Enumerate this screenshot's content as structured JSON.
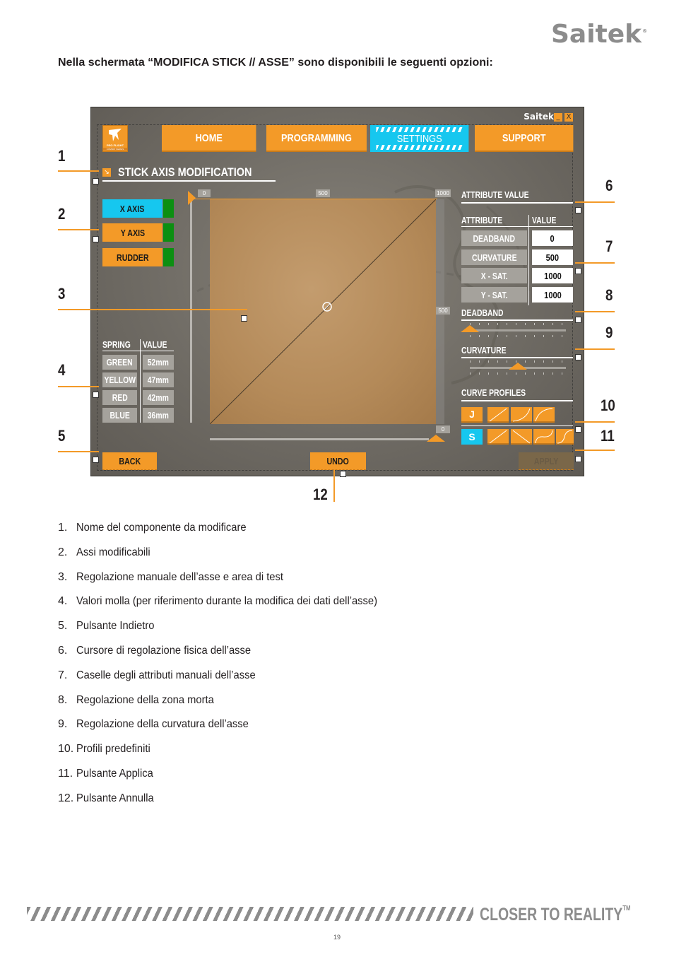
{
  "header": {
    "brand": "Saitek",
    "brand_mark": "®"
  },
  "intro": "Nella schermata “MODIFICA STICK // ASSE” sono disponibili le seguenti opzioni:",
  "app": {
    "brand": "Saitek",
    "minimize_label": "_",
    "close_label": "X",
    "logo_line1": "PRO FLIGHT",
    "logo_line2": "COMBAT SERIES",
    "nav": [
      {
        "label": "HOME",
        "active": false
      },
      {
        "label": "PROGRAMMING",
        "active": false
      },
      {
        "label": "SETTINGS",
        "active": true
      },
      {
        "label": "SUPPORT",
        "active": false
      }
    ],
    "section_title": "STICK  AXIS MODIFICATION",
    "section_icon": "↘",
    "axes": [
      {
        "label": "X AXIS",
        "selected": true
      },
      {
        "label": "Y AXIS",
        "selected": false
      },
      {
        "label": "RUDDER",
        "selected": false
      }
    ],
    "spring": {
      "col_spring": "SPRING",
      "col_value": "VALUE",
      "rows": [
        {
          "name": "GREEN",
          "value": "52mm"
        },
        {
          "name": "YELLOW",
          "value": "47mm"
        },
        {
          "name": "RED",
          "value": "42mm"
        },
        {
          "name": "BLUE",
          "value": "36mm"
        }
      ]
    },
    "graph": {
      "top_ticks": [
        "0",
        "500",
        "1000"
      ],
      "right_ticks": [
        "500",
        "0"
      ],
      "curve": "linear"
    },
    "attributes": {
      "title": "ATTRIBUTE VALUE",
      "col_attribute": "ATTRIBUTE",
      "col_value": "VALUE",
      "rows": [
        {
          "name": "DEADBAND",
          "value": "0"
        },
        {
          "name": "CURVATURE",
          "value": "500"
        },
        {
          "name": "X - SAT.",
          "value": "1000"
        },
        {
          "name": "Y - SAT.",
          "value": "1000"
        }
      ]
    },
    "deadband": {
      "label": "DEADBAND",
      "value_fraction": 0.0
    },
    "curvature": {
      "label": "CURVATURE",
      "value_fraction": 0.5
    },
    "profiles": {
      "title": "CURVE PROFILES",
      "row1_label": "J",
      "row2_label": "S"
    },
    "buttons": {
      "back": "BACK",
      "undo": "UNDO",
      "apply": "APPLY"
    }
  },
  "callouts": [
    "1",
    "2",
    "3",
    "4",
    "5",
    "6",
    "7",
    "8",
    "9",
    "10",
    "11",
    "12"
  ],
  "legend": [
    {
      "n": "1.",
      "text": "Nome del componente da modificare"
    },
    {
      "n": "2.",
      "text": "Assi modificabili"
    },
    {
      "n": "3.",
      "text": "Regolazione manuale dell’asse e area di test"
    },
    {
      "n": "4.",
      "text": "Valori molla (per riferimento durante la modifica dei dati dell’asse)"
    },
    {
      "n": "5.",
      "text": "Pulsante Indietro"
    },
    {
      "n": "6.",
      "text": "Cursore di regolazione fisica dell’asse"
    },
    {
      "n": "7.",
      "text": "Caselle degli attributi manuali dell’asse"
    },
    {
      "n": "8.",
      "text": "Regolazione della zona morta"
    },
    {
      "n": "9.",
      "text": "Regolazione della curvatura dell’asse"
    },
    {
      "n": "10.",
      "text": "Profili predefiniti"
    },
    {
      "n": "11.",
      "text": "Pulsante Applica"
    },
    {
      "n": "12.",
      "text": "Pulsante Annulla"
    }
  ],
  "footer": {
    "tagline": "CLOSER TO REALITY",
    "tm": "TM",
    "page": "19"
  }
}
